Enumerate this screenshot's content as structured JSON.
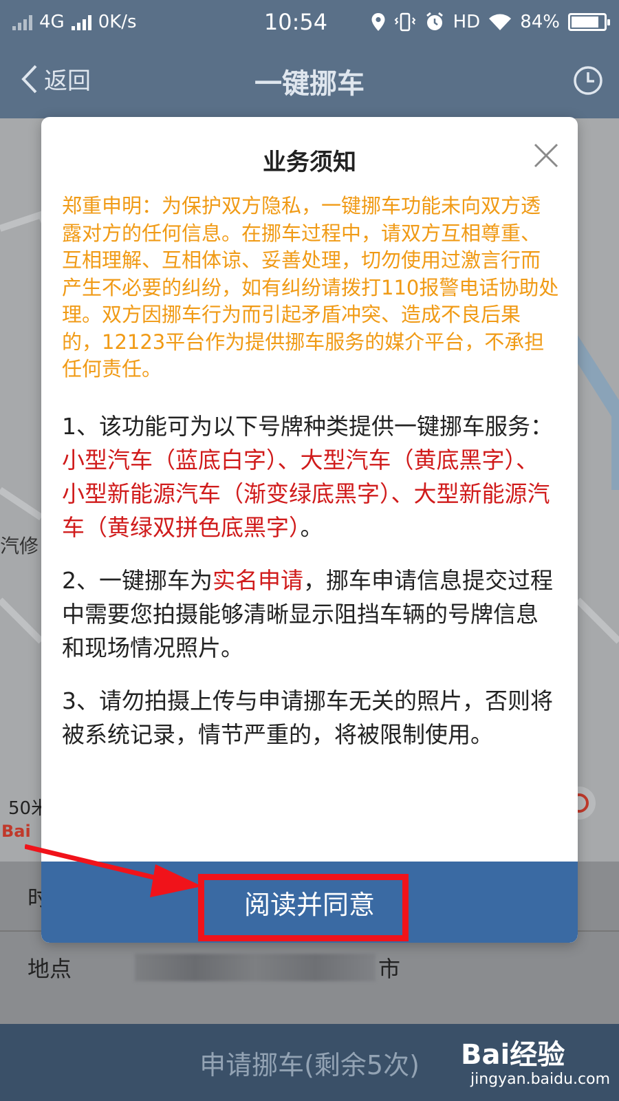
{
  "status_bar": {
    "network": "4G",
    "speed": "0K/s",
    "time": "10:54",
    "hd": "HD",
    "battery": "84%",
    "battery_level": 0.84
  },
  "nav": {
    "back_label": "返回",
    "title": "一键挪车"
  },
  "map": {
    "poi_label": "汽修",
    "scale_label": "50米",
    "logo_text": "Bai"
  },
  "form": {
    "time_label": "时",
    "location_label": "地点",
    "location_suffix": "市"
  },
  "apply_button": "申请挪车(剩余5次)",
  "modal": {
    "title": "业务须知",
    "notice": "郑重申明：为保护双方隐私，一键挪车功能未向双方透露对方的任何信息。在挪车过程中，请双方互相尊重、互相理解、互相体谅、妥善处理，切勿使用过激言行而产生不必要的纠纷，如有纠纷请拨打110报警电话协助处理。双方因挪车行为而引起矛盾冲突、造成不良后果的，12123平台作为提供挪车服务的媒介平台，不承担任何责任。",
    "item1_prefix": "1、该功能可为以下号牌种类提供一键挪车服务：",
    "item1_highlight": "小型汽车（蓝底白字）、大型汽车（黄底黑字）、小型新能源汽车（渐变绿底黑字）、大型新能源汽车（黄绿双拼色底黑字）",
    "item1_suffix": "。",
    "item2_prefix": "2、一键挪车为",
    "item2_highlight": "实名申请",
    "item2_suffix": "，挪车申请信息提交过程中需要您拍摄能够清晰显示阻挡车辆的号牌信息和现场情况照片。",
    "item3": "3、请勿拍摄上传与申请挪车无关的照片，否则将被系统记录，情节严重的，将被限制使用。",
    "agree_button": "阅读并同意"
  },
  "watermark": {
    "brand": "Bai经验",
    "site": "jingyan.baidu.com"
  },
  "colors": {
    "header": "#5a7088",
    "notice": "#f09a15",
    "highlight": "#d01b1b",
    "agree": "#3a6aa3",
    "annotation": "#f0131a"
  }
}
